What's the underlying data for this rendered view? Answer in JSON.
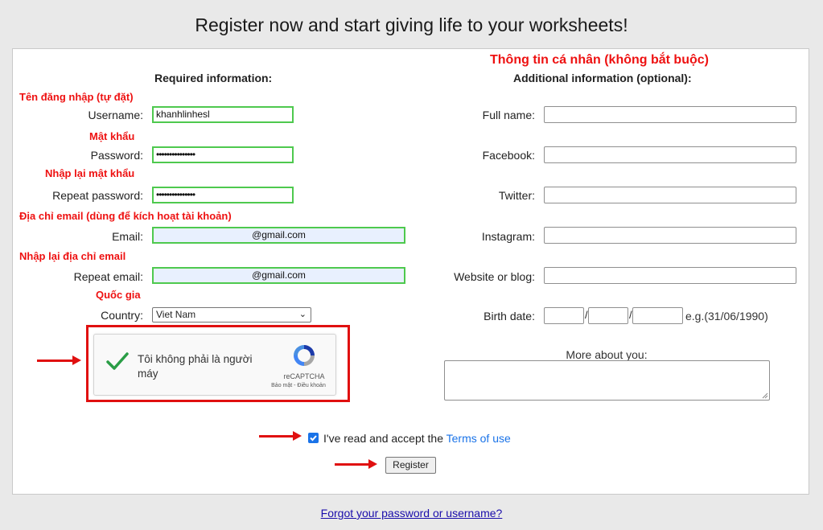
{
  "page_title": "Register now and start giving life to your worksheets!",
  "required": {
    "heading": "Required information:",
    "username": {
      "note": "Tên đăng nhập (tự đặt)",
      "label": "Username:",
      "value": "khanhlinhesl"
    },
    "password": {
      "note": "Mật khẩu",
      "label": "Password:",
      "value": "•••••••••••••••"
    },
    "repeat_password": {
      "note": "Nhập lại mật khẩu",
      "label": "Repeat password:",
      "value": "•••••••••••••••"
    },
    "email": {
      "note": "Địa chỉ email (dùng để kích hoạt tài khoản)",
      "label": "Email:",
      "value": "@gmail.com"
    },
    "repeat_email": {
      "note": "Nhập lại địa chỉ email",
      "label": "Repeat email:",
      "value": "@gmail.com"
    },
    "country": {
      "note": "Quốc gia",
      "label": "Country:",
      "value": "Viet Nam"
    }
  },
  "captcha": {
    "text": "Tôi không phải là người máy",
    "brand": "reCAPTCHA",
    "links": "Bảo mật - Điều khoản"
  },
  "optional": {
    "note": "Thông tin cá nhân (không bắt buộc)",
    "heading": "Additional information (optional):",
    "full_name": {
      "label": "Full name:",
      "value": ""
    },
    "facebook": {
      "label": "Facebook:",
      "value": ""
    },
    "twitter": {
      "label": "Twitter:",
      "value": ""
    },
    "instagram": {
      "label": "Instagram:",
      "value": ""
    },
    "website": {
      "label": "Website or blog:",
      "value": ""
    },
    "birth_date": {
      "label": "Birth date:",
      "separator": "/",
      "example": "e.g.(31/06/1990)"
    },
    "more_about": {
      "label": "More about you:",
      "value": ""
    }
  },
  "terms": {
    "text": "I've read and accept the ",
    "link": "Terms of use",
    "checked": true
  },
  "register_button": "Register",
  "forgot_link": "Forgot your password or username?",
  "colors": {
    "annotation_red": "#ee1111",
    "field_green": "#4ec94e",
    "link_blue": "#1a73e8"
  }
}
